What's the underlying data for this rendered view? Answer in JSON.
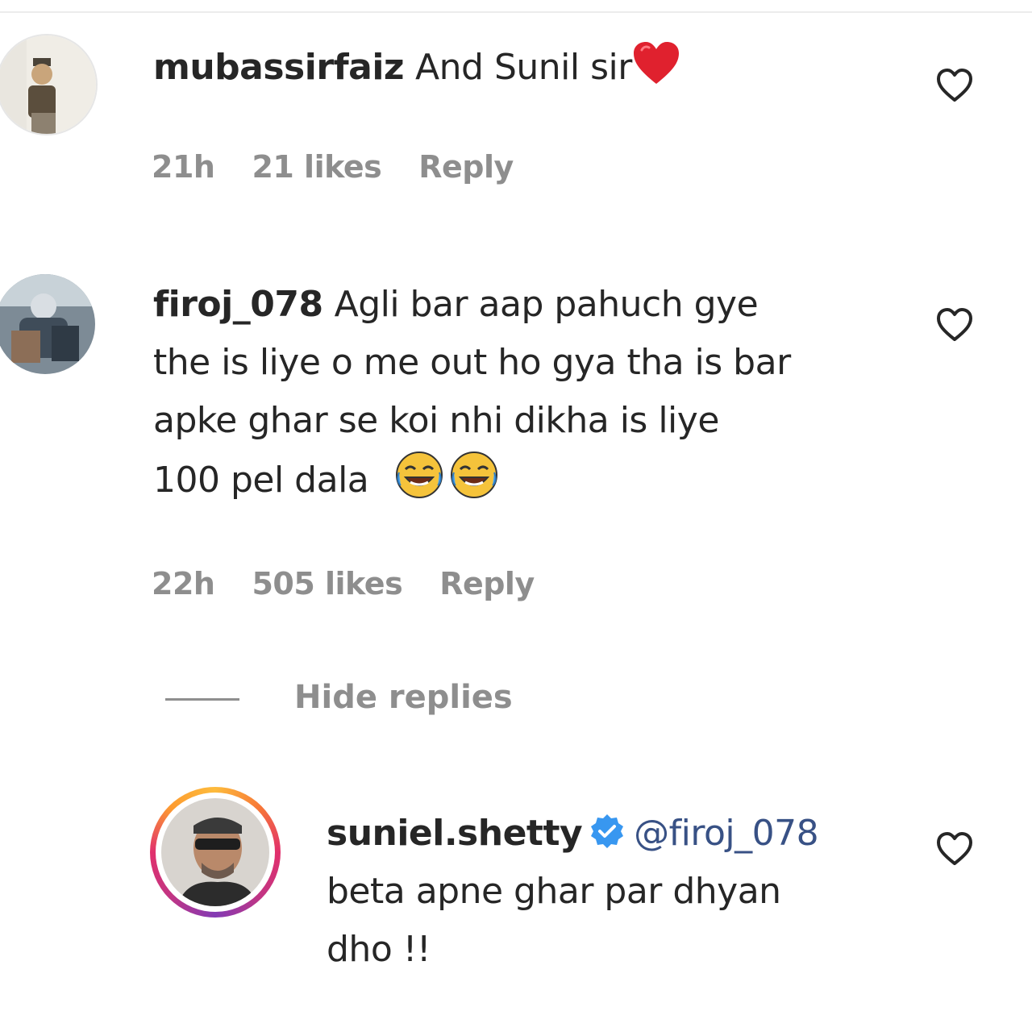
{
  "comments": [
    {
      "username": "mubassirfaiz",
      "text": "And Sunil sir",
      "emoji": "red-heart",
      "time": "21h",
      "likes": "21 likes",
      "reply": "Reply"
    },
    {
      "username": "firoj_078",
      "text_lines": [
        "Agli bar aap pahuch gye",
        "the is liye o me out ho gya tha is bar",
        "apke ghar se koi nhi dikha is liye",
        "100 pel dala"
      ],
      "emoji": "face-with-tears-of-joy",
      "time": "22h",
      "likes": "505 likes",
      "reply": "Reply"
    }
  ],
  "replies_toggle": "Hide replies",
  "reply": {
    "username": "suniel.shetty",
    "verified_icon": "verified-badge-icon",
    "mention": "@firoj_078",
    "text_lines": [
      "beta apne ghar par dhyan",
      "dho !!"
    ]
  },
  "colors": {
    "text": "#262626",
    "meta": "#8e8e8e",
    "mention": "#385185",
    "verified": "#3897f0"
  }
}
